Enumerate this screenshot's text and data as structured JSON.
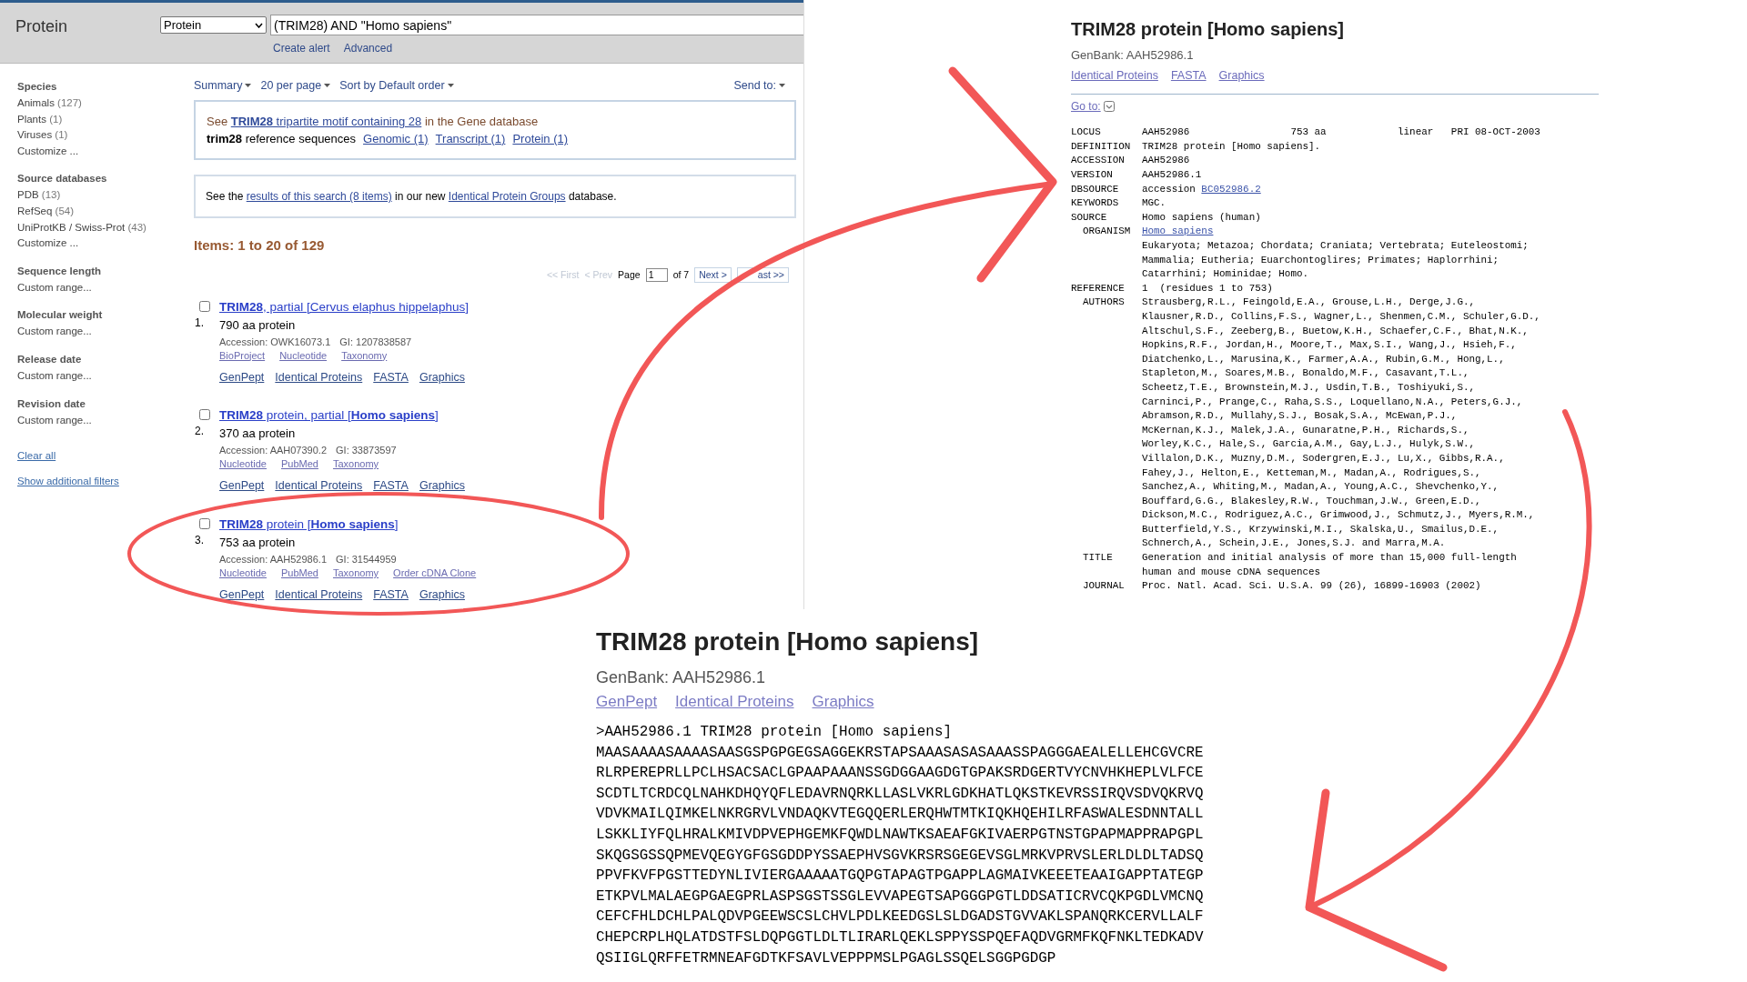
{
  "search_page": {
    "app_title": "Protein",
    "database_select": "Protein",
    "query": "(TRIM28) AND \"Homo sapiens\"",
    "header_links": [
      "Create alert",
      "Advanced"
    ],
    "filters": [
      {
        "heading": "Species",
        "items": [
          {
            "label": "Animals",
            "count": "(127)"
          },
          {
            "label": "Plants",
            "count": "(1)"
          },
          {
            "label": "Viruses",
            "count": "(1)"
          },
          {
            "label": "Customize ..."
          }
        ]
      },
      {
        "heading": "Source databases",
        "items": [
          {
            "label": "PDB",
            "count": "(13)"
          },
          {
            "label": "RefSeq",
            "count": "(54)"
          },
          {
            "label": "UniProtKB / Swiss-Prot",
            "count": "(43)"
          },
          {
            "label": "Customize ..."
          }
        ]
      },
      {
        "heading": "Sequence length",
        "items": [
          {
            "label": "Custom range..."
          }
        ]
      },
      {
        "heading": "Molecular weight",
        "items": [
          {
            "label": "Custom range..."
          }
        ]
      },
      {
        "heading": "Release date",
        "items": [
          {
            "label": "Custom range..."
          }
        ]
      },
      {
        "heading": "Revision date",
        "items": [
          {
            "label": "Custom range..."
          }
        ]
      }
    ],
    "filter_links": [
      "Clear all",
      "Show additional filters"
    ],
    "display_options": [
      "Summary",
      "20 per page",
      "Sort by Default order"
    ],
    "send_to": "Send to:",
    "gene_notice": [
      [
        {
          "text": "See "
        },
        {
          "link": "**TRIM28** tripartite motif containing 28"
        },
        {
          "text": " in the Gene database"
        }
      ],
      [
        {
          "text": "**trim28** reference sequences "
        },
        {
          "link": "Genomic (1)"
        },
        {
          "link": "Transcript (1)"
        },
        {
          "link": "Protein (1)"
        }
      ]
    ],
    "ipg_notice": [
      {
        "text": "See the "
      },
      {
        "link": "results of this search (8 items)"
      },
      {
        "text": " in our new "
      },
      {
        "link": "Identical Protein Groups"
      },
      {
        "text": " database."
      }
    ],
    "items_count": "Items: 1 to 20 of 129",
    "pager": [
      {
        "kind": "link",
        "label": "<< First",
        "disabled": true
      },
      {
        "kind": "link",
        "label": "< Prev",
        "disabled": true
      },
      {
        "kind": "text",
        "label": "Page"
      },
      {
        "kind": "input",
        "label": "1"
      },
      {
        "kind": "text",
        "label": "of 7"
      },
      {
        "kind": "button",
        "label": "Next >",
        "disabled": false
      },
      {
        "kind": "button",
        "label": "ast >>",
        "disabled": false
      }
    ],
    "results": [
      {
        "number": "1.",
        "selected": false,
        "title": "**TRIM28**, partial [Cervus elaphus hippelaphus]",
        "length": "790 aa protein",
        "accession": "Accession: OWK16073.1",
        "gi": "GI: 1207838587",
        "related_links": [
          "BioProject",
          "Nucleotide",
          "Taxonomy"
        ],
        "links": [
          "GenPept",
          "Identical Proteins",
          "FASTA",
          "Graphics"
        ]
      },
      {
        "number": "2.",
        "selected": false,
        "title": "**TRIM28** protein, partial [**Homo sapiens**]",
        "length": "370 aa protein",
        "accession": "Accession: AAH07390.2",
        "gi": "GI: 33873597",
        "related_links": [
          "Nucleotide",
          "PubMed",
          "Taxonomy"
        ],
        "links": [
          "GenPept",
          "Identical Proteins",
          "FASTA",
          "Graphics"
        ]
      },
      {
        "number": "3.",
        "selected": false,
        "title": "**TRIM28** protein [**Homo sapiens**]",
        "length": "753 aa protein",
        "accession": "Accession: AAH52986.1",
        "gi": "GI: 31544959",
        "related_links": [
          "Nucleotide",
          "PubMed",
          "Taxonomy",
          "Order cDNA Clone"
        ],
        "links": [
          "GenPept",
          "Identical Proteins",
          "FASTA",
          "Graphics"
        ]
      }
    ]
  },
  "record_page": {
    "title": "TRIM28 protein [Homo sapiens]",
    "genbank": "GenBank: AAH52986.1",
    "links": [
      "Identical Proteins",
      "FASTA",
      "Graphics"
    ],
    "goto": "Go to:",
    "record": [
      {
        "label": "LOCUS",
        "sub": false,
        "text": "AAH52986                 753 aa            linear   PRI 08-OCT-2003"
      },
      {
        "label": "DEFINITION",
        "sub": false,
        "text": "TRIM28 protein [Homo sapiens]."
      },
      {
        "label": "ACCESSION",
        "sub": false,
        "text": "AAH52986"
      },
      {
        "label": "VERSION",
        "sub": false,
        "text": "AAH52986.1"
      },
      {
        "label": "DBSOURCE",
        "sub": false,
        "text": "accession",
        "link": "BC052986.2"
      },
      {
        "label": "KEYWORDS",
        "sub": false,
        "text": "MGC."
      },
      {
        "label": "SOURCE",
        "sub": false,
        "text": "Homo sapiens (human)"
      },
      {
        "label": "ORGANISM",
        "sub": true,
        "link": "Homo sapiens",
        "lines": [
          "Eukaryota; Metazoa; Chordata; Craniata; Vertebrata; Euteleostomi;",
          "Mammalia; Eutheria; Euarchontoglires; Primates; Haplorrhini;",
          "Catarrhini; Hominidae; Homo."
        ]
      },
      {
        "label": "REFERENCE",
        "sub": false,
        "text": "1  (residues 1 to 753)"
      },
      {
        "label": "AUTHORS",
        "sub": true,
        "text": "Strausberg,R.L., Feingold,E.A., Grouse,L.H., Derge,J.G.,",
        "lines": [
          "Klausner,R.D., Collins,F.S., Wagner,L., Shenmen,C.M., Schuler,G.D.,",
          "Altschul,S.F., Zeeberg,B., Buetow,K.H., Schaefer,C.F., Bhat,N.K.,",
          "Hopkins,R.F., Jordan,H., Moore,T., Max,S.I., Wang,J., Hsieh,F.,",
          "Diatchenko,L., Marusina,K., Farmer,A.A., Rubin,G.M., Hong,L.,",
          "Stapleton,M., Soares,M.B., Bonaldo,M.F., Casavant,T.L.,",
          "Scheetz,T.E., Brownstein,M.J., Usdin,T.B., Toshiyuki,S.,",
          "Carninci,P., Prange,C., Raha,S.S., Loquellano,N.A., Peters,G.J.,",
          "Abramson,R.D., Mullahy,S.J., Bosak,S.A., McEwan,P.J.,",
          "McKernan,K.J., Malek,J.A., Gunaratne,P.H., Richards,S.,",
          "Worley,K.C., Hale,S., Garcia,A.M., Gay,L.J., Hulyk,S.W.,",
          "Villalon,D.K., Muzny,D.M., Sodergren,E.J., Lu,X., Gibbs,R.A.,",
          "Fahey,J., Helton,E., Ketteman,M., Madan,A., Rodrigues,S.,",
          "Sanchez,A., Whiting,M., Madan,A., Young,A.C., Shevchenko,Y.,",
          "Bouffard,G.G., Blakesley,R.W., Touchman,J.W., Green,E.D.,",
          "Dickson,M.C., Rodriguez,A.C., Grimwood,J., Schmutz,J., Myers,R.M.,",
          "Butterfield,Y.S., Krzywinski,M.I., Skalska,U., Smailus,D.E.,",
          "Schnerch,A., Schein,J.E., Jones,S.J. and Marra,M.A."
        ]
      },
      {
        "label": "TITLE",
        "sub": true,
        "text": "Generation and initial analysis of more than 15,000 full-length",
        "lines": [
          "human and mouse cDNA sequences"
        ]
      },
      {
        "label": "JOURNAL",
        "sub": true,
        "text": "Proc. Natl. Acad. Sci. U.S.A. 99 (26), 16899-16903 (2002)"
      }
    ]
  },
  "fasta_page": {
    "title": "TRIM28 protein [Homo sapiens]",
    "genbank": "GenBank: AAH52986.1",
    "links": [
      "GenPept",
      "Identical Proteins",
      "Graphics"
    ],
    "defline": ">AAH52986.1 TRIM28 protein [Homo sapiens]",
    "sequence": [
      "MAASAAAASAAAASAASGSPGPGEGSAGGEKRSTAPSAAASASASAAASSPAGGGAEALELLEHCGVCRE",
      "RLRPEREPRLLPCLHSACSACLGPAAPAAANSSGDGGAAGDGTGPAKSRDGERTVYCNVHKHEPLVLFCE",
      "SCDTLTCRDCQLNAHKDHQYQFLEDAVRNQRKLLASLVKRLGDKHATLQKSTKEVRSSIRQVSDVQKRVQ",
      "VDVKMAILQIMKELNKRGRVLVNDAQKVTEGQQERLERQHWTMTKIQKHQEHILRFASWALESDNNTALL",
      "LSKKLIYFQLHRALKMIVDPVEPHGEMKFQWDLNAWTKSAEAFGKIVAERPGTNSTGPAPMAPPRAPGPL",
      "SKQGSGSSQPMEVQEGYGFGSGDDPYSSAEPHVSGVKRSRSGEGEVSGLMRKVPRVSLERLDLDLTADSQ",
      "PPVFKVFPGSTTEDYNLIVIERGAAAAATGQPGTAPAGTPGAPPLAGMAIVKEEETEAAIGAPPTATEGP",
      "ETKPVLMALAEGPGAEGPRLASPSGSTSSGLEVVAPEGTSAPGGGPGTLDDSATICRVCQKPGDLVMCNQ",
      "CEFCFHLDCHLPALQDVPGEEWSCSLCHVLPDLKEEDGSLSLDGADSTGVVAKLSPANQRKCERVLLALF",
      "CHEPCRPLHQLATDSTFSLDQPGGTLDLTLIRARLQEKLSPPYSSPQEFAQDVGRMFKQFNKLTEDKADV",
      "QSIIGLQRFFETRMNEAFGDTKFSAVLVEPPPMSLPGAGLSSQELSGGPGDGP"
    ]
  }
}
